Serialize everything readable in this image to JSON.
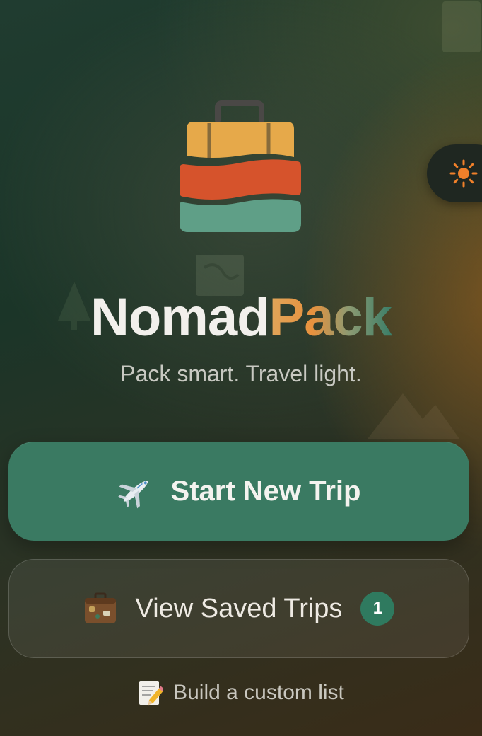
{
  "app": {
    "brand_part1": "Nomad",
    "brand_part2": "Pack",
    "tagline": "Pack smart. Travel light."
  },
  "theme_toggle": {
    "icon": "sun-icon",
    "color": "#f0802a"
  },
  "actions": {
    "start_new_trip": {
      "label": "Start New Trip",
      "icon": "airplane-icon"
    },
    "view_saved_trips": {
      "label": "View Saved Trips",
      "icon": "suitcase-icon",
      "badge_count": "1"
    },
    "build_custom_list": {
      "label": "Build a custom list",
      "icon": "memo-icon"
    }
  },
  "colors": {
    "primary_button": "#3a7a62",
    "badge": "#2f7a5f",
    "logo_top": "#e6a94a",
    "logo_middle": "#d6532c",
    "logo_bottom": "#5f9f87"
  }
}
